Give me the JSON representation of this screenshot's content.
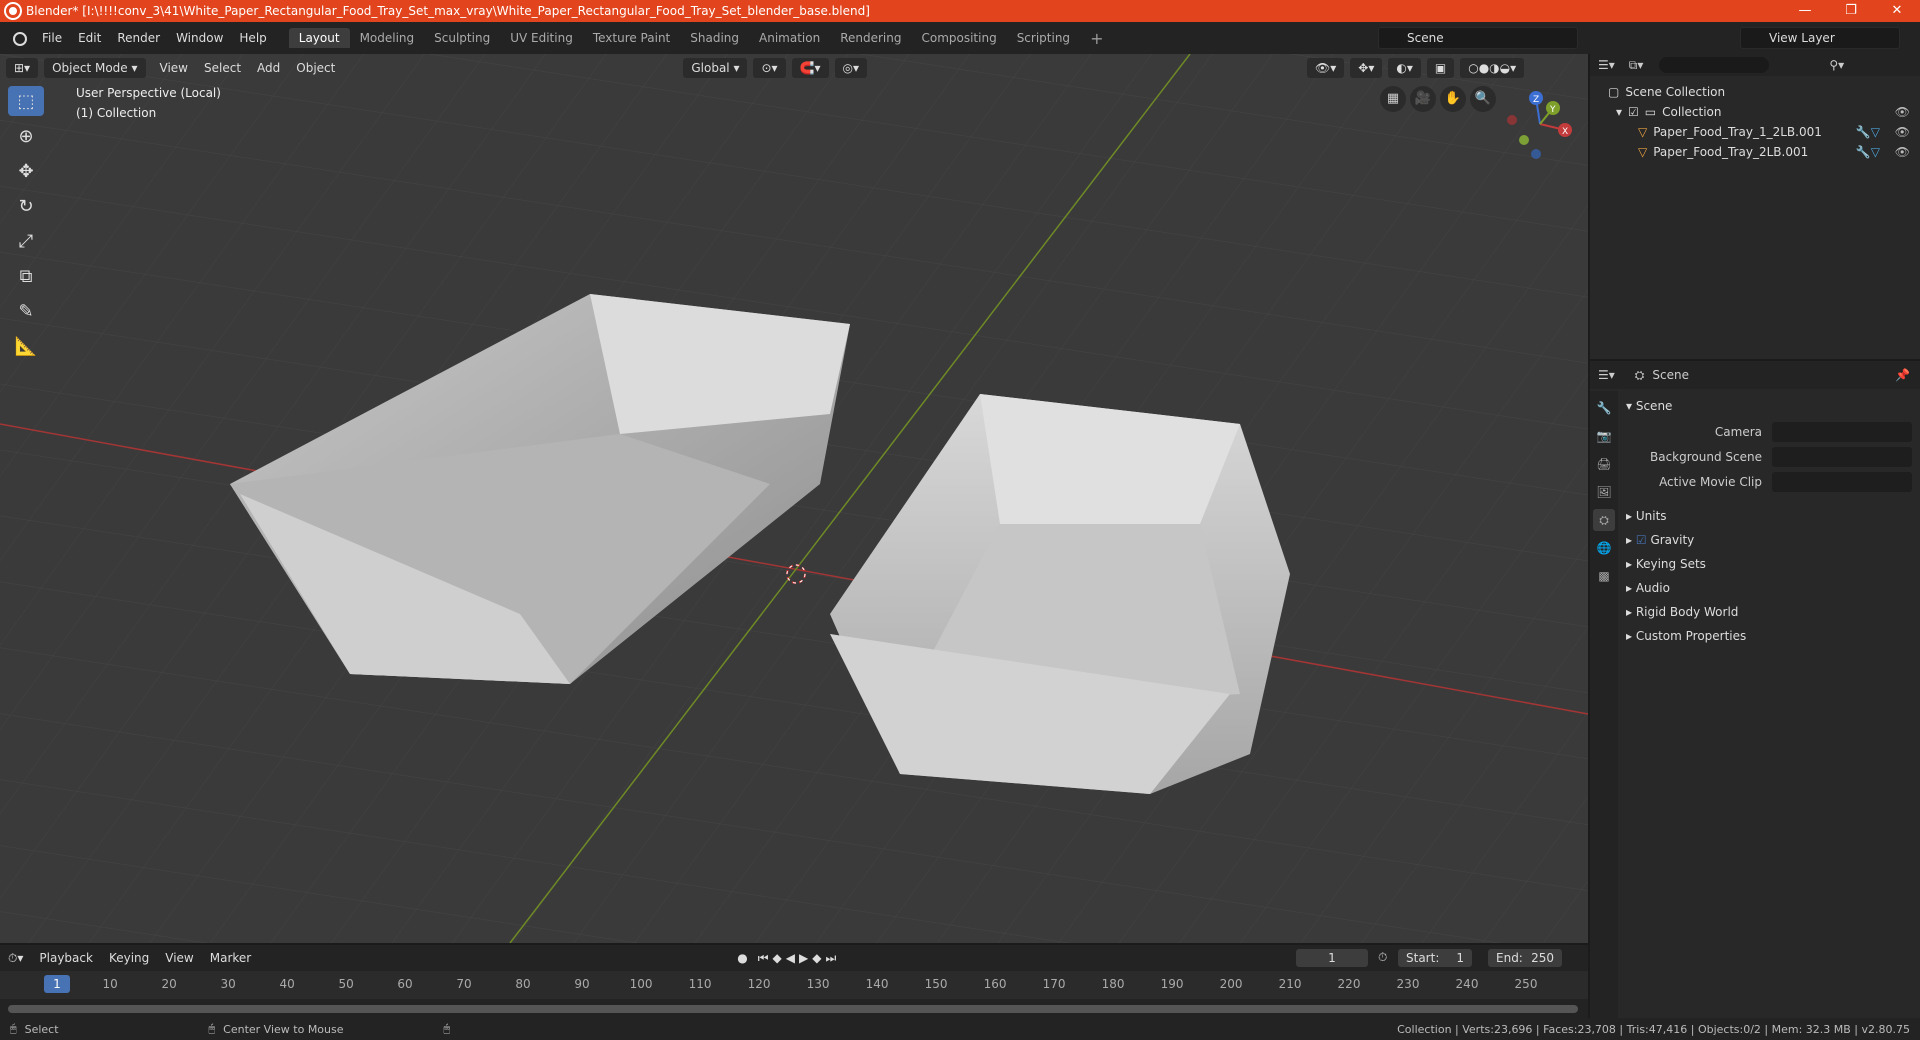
{
  "window": {
    "title": "Blender* [I:\\!!!!conv_3\\41\\White_Paper_Rectangular_Food_Tray_Set_max_vray\\White_Paper_Rectangular_Food_Tray_Set_blender_base.blend]",
    "min": "—",
    "max": "❐",
    "close": "✕"
  },
  "menu": [
    "File",
    "Edit",
    "Render",
    "Window",
    "Help"
  ],
  "workspaces": [
    "Layout",
    "Modeling",
    "Sculpting",
    "UV Editing",
    "Texture Paint",
    "Shading",
    "Animation",
    "Rendering",
    "Compositing",
    "Scripting"
  ],
  "active_workspace": "Layout",
  "add_tab": "+",
  "scene_name": "Scene",
  "view_layer": "View Layer",
  "viewport": {
    "mode": "Object Mode",
    "menus": [
      "View",
      "Select",
      "Add",
      "Object"
    ],
    "orientation": "Global",
    "perspective": "User Perspective (Local)",
    "collection": "(1) Collection",
    "axis": {
      "x": "X",
      "y": "Y",
      "z": "Z"
    }
  },
  "outliner": {
    "root": "Scene Collection",
    "collection": "Collection",
    "objects": [
      "Paper_Food_Tray_1_2LB.001",
      "Paper_Food_Tray_2LB.001"
    ]
  },
  "properties": {
    "header": "Scene",
    "panel": "Scene",
    "fields": [
      {
        "label": "Camera"
      },
      {
        "label": "Background Scene"
      },
      {
        "label": "Active Movie Clip"
      }
    ],
    "sections": [
      "Units",
      "Gravity",
      "Keying Sets",
      "Audio",
      "Rigid Body World",
      "Custom Properties"
    ]
  },
  "timeline": {
    "menus": [
      "Playback",
      "Keying",
      "View",
      "Marker"
    ],
    "current_frame": "1",
    "start_label": "Start:",
    "start": "1",
    "end_label": "End:",
    "end": "250",
    "ticks": [
      "1",
      "10",
      "20",
      "30",
      "40",
      "50",
      "60",
      "70",
      "80",
      "90",
      "100",
      "110",
      "120",
      "130",
      "140",
      "150",
      "160",
      "170",
      "180",
      "190",
      "200",
      "210",
      "220",
      "230",
      "240",
      "250"
    ]
  },
  "status": {
    "left": "Select",
    "middle": "Center View to Mouse",
    "right": "Collection | Verts:23,696 | Faces:23,708 | Tris:47,416 | Objects:0/2 | Mem: 32.3 MB | v2.80.75"
  },
  "colors": {
    "accent": "#4772b3",
    "titlebar": "#e2451d",
    "x_axis": "#c33b3b",
    "y_axis": "#7ea02a",
    "z_axis": "#3b6fd4"
  }
}
